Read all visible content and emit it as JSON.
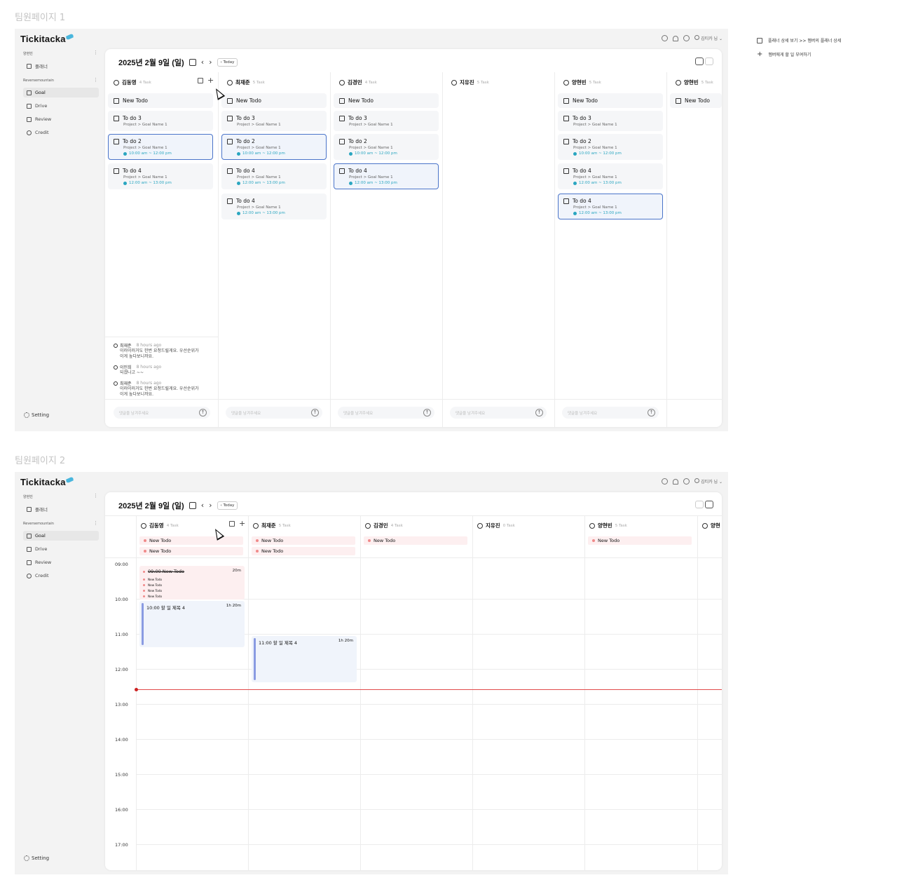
{
  "page1_label": "팀원페이지 1",
  "page2_label": "팀원페이지 2",
  "app": {
    "logo": "Tickitacka",
    "user_name": "김티카 님",
    "workspace_personal": "양현빈",
    "planner_label": "플래너",
    "workspace_team": "Reversemountain",
    "nav": [
      "Goal",
      "Drive",
      "Review",
      "Credit"
    ],
    "setting": "Setting"
  },
  "header": {
    "date": "2025년 2월 9일 (일)",
    "today": "Today"
  },
  "board": {
    "columns": [
      {
        "name": "김동영",
        "count": "4 Task"
      },
      {
        "name": "최재준",
        "count": "5 Task"
      },
      {
        "name": "김경민",
        "count": "4 Task"
      },
      {
        "name": "지유진",
        "count": "5 Task"
      },
      {
        "name": "양현빈",
        "count": "5 Task"
      },
      {
        "name": "양현빈",
        "count": "5 Task"
      }
    ],
    "new_todo": "New Todo",
    "todo3": "To do 3",
    "todo2": "To do 2",
    "todo4": "To do 4",
    "sub": "Project > Goal Name 1",
    "time_a": "10:00 am ~ 12:00 pm",
    "time_b": "12:00 am ~ 13:00 pm",
    "comment_placeholder": "댓글을 남겨주세요",
    "comments": [
      {
        "who": "최재준",
        "ago": "8 hours ago",
        "text1": "이러이러거도 한번 요청드릴게요. 우선순위가",
        "text2": "이게 높다보니까요."
      },
      {
        "who": "이민희",
        "ago": "8 hours ago",
        "text1": "되겠나고 ~~",
        "text2": ""
      },
      {
        "who": "최재준",
        "ago": "8 hours ago",
        "text1": "이러이러거도 한번 요청드릴게요. 우선순위가",
        "text2": "이게 높다보니까요."
      }
    ]
  },
  "timeline": {
    "columns": [
      {
        "name": "김동영",
        "count": "4 Task"
      },
      {
        "name": "최재준",
        "count": "5 Task"
      },
      {
        "name": "김경민",
        "count": "4 Task"
      },
      {
        "name": "지유진",
        "count": "0 Task"
      },
      {
        "name": "양현빈",
        "count": "5 Task"
      },
      {
        "name": "양현",
        "count": ""
      }
    ],
    "hours": [
      "09:00",
      "10:00",
      "11:00",
      "12:00",
      "13:00",
      "14:00",
      "15:00",
      "16:00",
      "17:00"
    ],
    "strike_event": "09:00 New Todo",
    "strike_dur": "20m",
    "small_todo": "New Todo",
    "event1": "10:00 할 일 제목 4",
    "event1_dur": "1h 20m",
    "event2": "11:00 할 일 제목 4",
    "event2_dur": "1h 20m"
  },
  "annotations": {
    "a1": "플래너 상세 보기 >> 멤버의 플래너 상세",
    "a2": "멤버에게 할 일 부여하기"
  }
}
